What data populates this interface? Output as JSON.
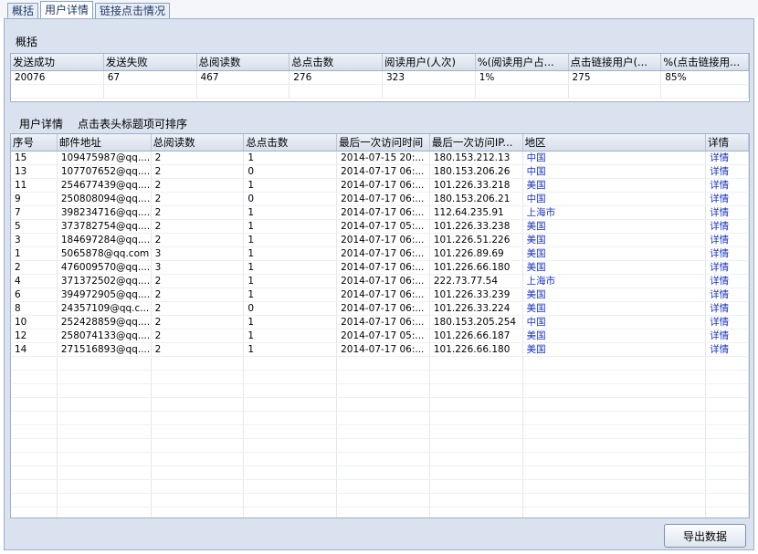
{
  "tabs": [
    "概括",
    "用户详情",
    "链接点击情况"
  ],
  "summary": {
    "title": "概括",
    "columns": [
      "发送成功",
      "发送失败",
      "总阅读数",
      "总点击数",
      "阅读用户(人次)",
      "%(阅读用户占...",
      "点击链接用户(...",
      "%(点击链接用..."
    ],
    "row": [
      "20076",
      "67",
      "467",
      "276",
      "323",
      "1%",
      "275",
      "85%"
    ]
  },
  "details": {
    "title": "用户详情",
    "hint": "点击表头标题项可排序",
    "columns": [
      "序号",
      "邮件地址",
      "总阅读数",
      "总点击数",
      "最后一次访问时间",
      "最后一次访问IP...",
      "地区",
      "详情"
    ],
    "rows": [
      [
        "15",
        "109475987@qq....",
        "2",
        "1",
        "2014-07-15 20:...",
        "180.153.212.13",
        "中国",
        "详情"
      ],
      [
        "13",
        "107707652@qq....",
        "2",
        "0",
        "2014-07-17 06:...",
        "180.153.206.26",
        "中国",
        "详情"
      ],
      [
        "11",
        "254677439@qq....",
        "2",
        "1",
        "2014-07-17 06:...",
        "101.226.33.218",
        "美国",
        "详情"
      ],
      [
        "9",
        "250808094@qq....",
        "2",
        "0",
        "2014-07-17 06:...",
        "180.153.206.21",
        "中国",
        "详情"
      ],
      [
        "7",
        "398234716@qq....",
        "2",
        "1",
        "2014-07-17 06:...",
        "112.64.235.91",
        "上海市",
        "详情"
      ],
      [
        "5",
        "373782754@qq....",
        "2",
        "1",
        "2014-07-17 05:...",
        "101.226.33.238",
        "美国",
        "详情"
      ],
      [
        "3",
        "184697284@qq....",
        "2",
        "1",
        "2014-07-17 06:...",
        "101.226.51.226",
        "美国",
        "详情"
      ],
      [
        "1",
        "5065878@qq.com",
        "3",
        "1",
        "2014-07-17 06:...",
        "101.226.89.69",
        "美国",
        "详情"
      ],
      [
        "2",
        "476009570@qq....",
        "3",
        "1",
        "2014-07-17 06:...",
        "101.226.66.180",
        "美国",
        "详情"
      ],
      [
        "4",
        "371372502@qq....",
        "2",
        "1",
        "2014-07-17 06:...",
        "222.73.77.54",
        "上海市",
        "详情"
      ],
      [
        "6",
        "394972905@qq....",
        "2",
        "1",
        "2014-07-17 06:...",
        "101.226.33.239",
        "美国",
        "详情"
      ],
      [
        "8",
        "24357109@qq.c...",
        "2",
        "0",
        "2014-07-17 06:...",
        "101.226.33.224",
        "美国",
        "详情"
      ],
      [
        "10",
        "252428859@qq....",
        "2",
        "1",
        "2014-07-17 06:...",
        "180.153.205.254",
        "中国",
        "详情"
      ],
      [
        "12",
        "258074133@qq....",
        "2",
        "1",
        "2014-07-17 05:...",
        "101.226.66.187",
        "美国",
        "详情"
      ],
      [
        "14",
        "271516893@qq....",
        "2",
        "1",
        "2014-07-17 06:...",
        "101.226.66.180",
        "美国",
        "详情"
      ]
    ]
  },
  "export_button": "导出数据"
}
